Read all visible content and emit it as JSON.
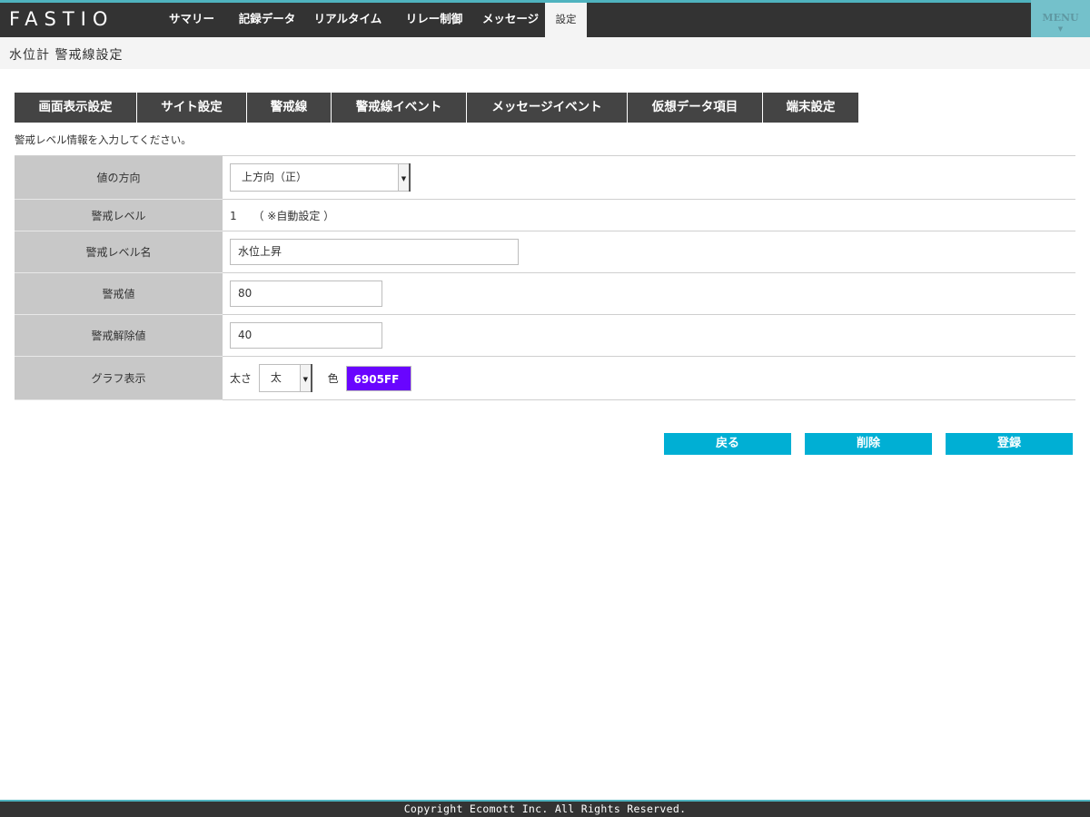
{
  "app": {
    "logo": "FASTIO",
    "menu_label": "MENU"
  },
  "nav": {
    "items": [
      {
        "label": "サマリー"
      },
      {
        "label": "記録データ"
      },
      {
        "label": "リアルタイム"
      },
      {
        "label": "リレー制御"
      },
      {
        "label": "メッセージ"
      },
      {
        "label": "設定",
        "active": true
      }
    ]
  },
  "page": {
    "title": "水位計 警戒線設定"
  },
  "subtabs": [
    {
      "label": "画面表示設定"
    },
    {
      "label": "サイト設定"
    },
    {
      "label": "警戒線"
    },
    {
      "label": "警戒線イベント"
    },
    {
      "label": "メッセージイベント"
    },
    {
      "label": "仮想データ項目"
    },
    {
      "label": "端末設定"
    }
  ],
  "instruction": "警戒レベル情報を入力してください。",
  "form": {
    "direction": {
      "label": "値の方向",
      "value": "上方向（正）"
    },
    "level": {
      "label": "警戒レベル",
      "value": "1",
      "note": "（ ※自動設定 ）"
    },
    "level_name": {
      "label": "警戒レベル名",
      "value": "水位上昇"
    },
    "alert_value": {
      "label": "警戒値",
      "value": "80"
    },
    "release_value": {
      "label": "警戒解除値",
      "value": "40"
    },
    "graph": {
      "label": "グラフ表示",
      "thickness_label": "太さ",
      "thickness_value": "太",
      "color_label": "色",
      "color_value": "6905FF",
      "color_hex": "#6905ff"
    }
  },
  "buttons": {
    "back": "戻る",
    "delete": "削除",
    "register": "登録"
  },
  "footer": {
    "copyright": "Copyright Ecomott Inc. All Rights Reserved."
  },
  "colors": {
    "accent": "#00afd4",
    "topbar": "#333333",
    "tab": "#444444",
    "strip": "#4fb3bf"
  }
}
